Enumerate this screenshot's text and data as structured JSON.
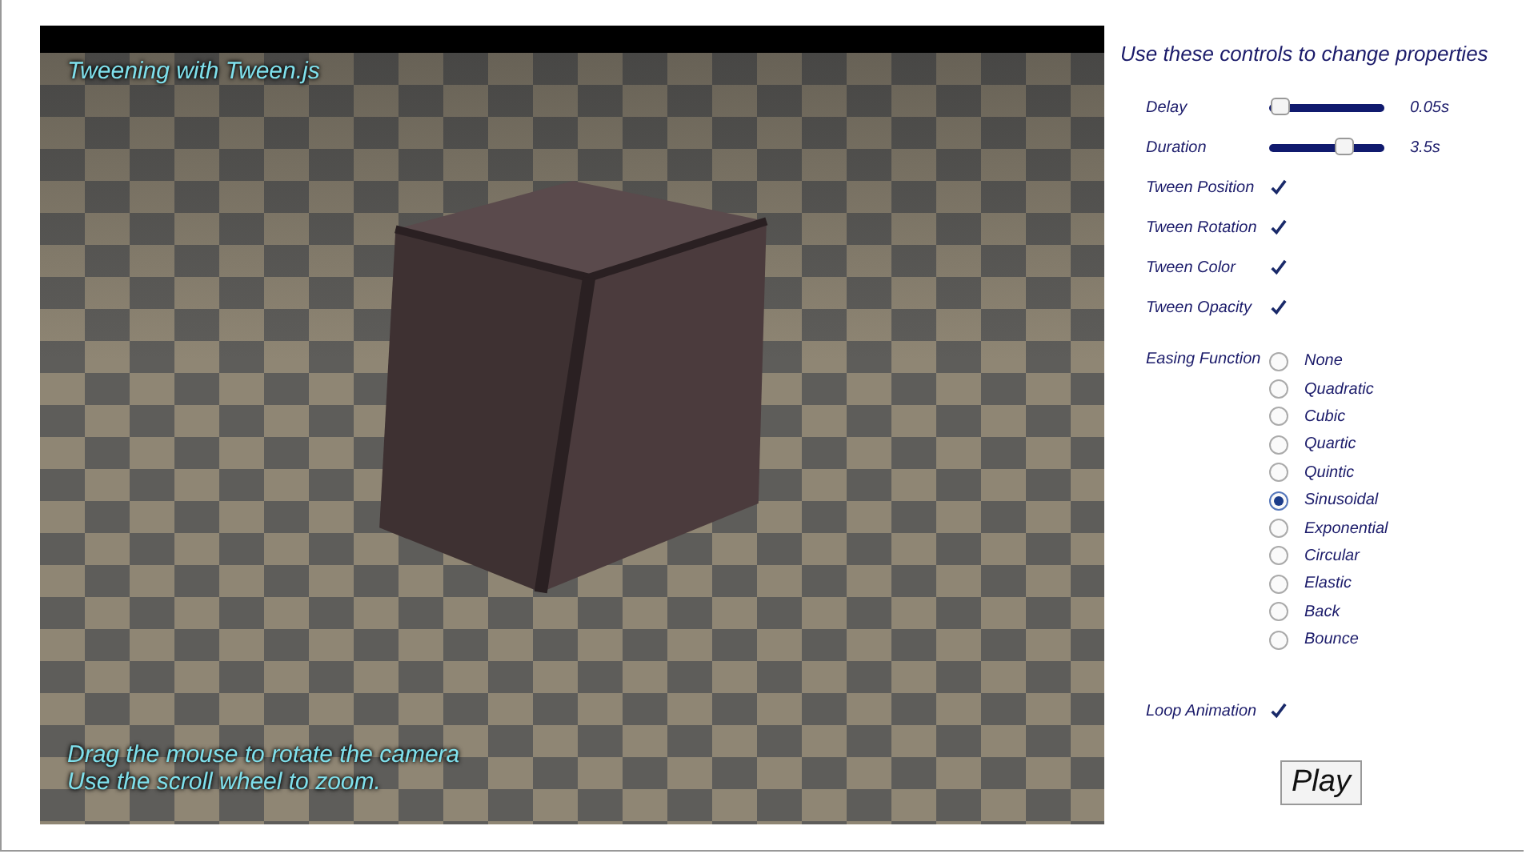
{
  "viewport": {
    "title": "Tweening with Tween.js",
    "hints": [
      "Drag the mouse to rotate the camera",
      "Use the scroll wheel to zoom."
    ]
  },
  "controls": {
    "heading": "Use these controls to change properties",
    "sliders": [
      {
        "label": "Delay",
        "level": 0.02,
        "reading": "0.05s"
      },
      {
        "label": "Duration",
        "level": 0.66,
        "reading": "3.5s"
      }
    ],
    "toggles": [
      {
        "label": "Tween Position",
        "checked": true
      },
      {
        "label": "Tween Rotation",
        "checked": true
      },
      {
        "label": "Tween Color",
        "checked": true
      },
      {
        "label": "Tween Opacity",
        "checked": true
      }
    ],
    "easing": {
      "label": "Easing Function",
      "options": [
        {
          "label": "None",
          "selected": false
        },
        {
          "label": "Quadratic",
          "selected": false
        },
        {
          "label": "Cubic",
          "selected": false
        },
        {
          "label": "Quartic",
          "selected": false
        },
        {
          "label": "Quintic",
          "selected": false
        },
        {
          "label": "Sinusoidal",
          "selected": true
        },
        {
          "label": "Exponential",
          "selected": false
        },
        {
          "label": "Circular",
          "selected": false
        },
        {
          "label": "Elastic",
          "selected": false
        },
        {
          "label": "Back",
          "selected": false
        },
        {
          "label": "Bounce",
          "selected": false
        }
      ]
    },
    "loop": {
      "label": "Loop Animation",
      "checked": true
    },
    "play_button": "Play"
  }
}
